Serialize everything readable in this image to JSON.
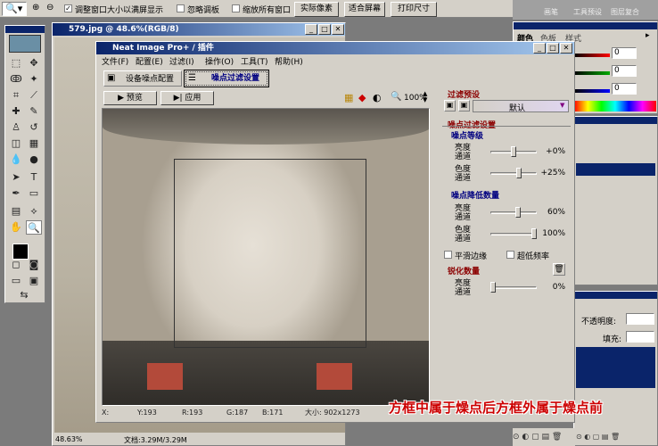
{
  "options_bar": {
    "resize_window_label": "调整窗口大小以满屏显示",
    "ignore_palettes_label": "忽略调板",
    "zoom_all_label": "缩放所有窗口",
    "actual_pixels": "实际像素",
    "fit_screen": "适合屏幕",
    "print_size": "打印尺寸"
  },
  "palette_well": {
    "tabs": [
      "画笔",
      "工具预设",
      "图层复合"
    ]
  },
  "color_palette": {
    "tabs": [
      "颜色",
      "色板",
      "样式"
    ],
    "r": "0",
    "g": "0",
    "b": "0"
  },
  "layers_palette": {
    "opacity_label": "不透明度:",
    "fill_label": "填充:"
  },
  "document": {
    "title": "579.jpg @ 48.6%(RGB/8)",
    "zoom": "48.63%",
    "doc_size": "文档:3.29M/3.29M"
  },
  "plugin": {
    "title": "Neat Image Pro+ / 插件",
    "menu": [
      "文件(F)",
      "配置(E)",
      "过滤(I)",
      "操作(O)",
      "工具(T)",
      "帮助(H)"
    ],
    "tabs": {
      "device_profile": "设备噪点配置",
      "noise_filter": "噪点过滤设置"
    },
    "preview_btn": "预览",
    "apply_btn": "应用",
    "zoom": "100%",
    "preset": {
      "title": "过滤预设",
      "value": "默认"
    },
    "noise_settings_title": "噪点过滤设置",
    "noise_level": {
      "title": "噪点等级",
      "sliders": [
        {
          "label": "亮度通道",
          "value": "+0%",
          "level": 0.5
        },
        {
          "label": "色度通道",
          "value": "+25%",
          "level": 0.62
        }
      ]
    },
    "noise_reduction": {
      "title": "噪点降低数量",
      "sliders": [
        {
          "label": "亮度通道",
          "value": "60%",
          "level": 0.6
        },
        {
          "label": "色度通道",
          "value": "100%",
          "level": 1.0
        }
      ]
    },
    "smooth_edges": "平滑边缘",
    "ultra_low_freq": "超低频率",
    "sharpen": {
      "title": "锐化数量",
      "sliders": [
        {
          "label": "亮度通道",
          "value": "0%",
          "level": 0.0
        }
      ]
    },
    "status": {
      "x": "X:",
      "y": "Y:193",
      "r": "R:193",
      "g": "G:187",
      "b": "B:171",
      "size": "大小: 902x1273"
    }
  },
  "annotation": "方框中属于燥点后方框外属于燥点前",
  "colors": {
    "annotation": "#cc0000",
    "titlebar": "#0a246a",
    "section_title": "#8b0000"
  }
}
